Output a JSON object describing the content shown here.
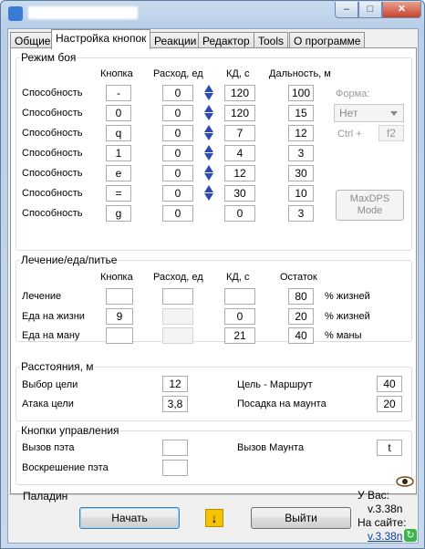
{
  "window": {
    "close_glyph": "✕",
    "min_glyph": "–",
    "max_glyph": "□"
  },
  "tabs": [
    "Общие",
    "Настройка кнопок",
    "Реакции",
    "Редактор",
    "Tools",
    "О программе"
  ],
  "combat": {
    "legend": "Режим боя",
    "headers": {
      "key": "Кнопка",
      "cost": "Расход, ед",
      "cd": "КД, с",
      "range": "Дальность, м"
    },
    "rows": [
      {
        "label": "Способность",
        "key": "-",
        "cost": "0",
        "cd": "120",
        "range": "100"
      },
      {
        "label": "Способность",
        "key": "0",
        "cost": "0",
        "cd": "120",
        "range": "15"
      },
      {
        "label": "Способность",
        "key": "q",
        "cost": "0",
        "cd": "7",
        "range": "12"
      },
      {
        "label": "Способность",
        "key": "1",
        "cost": "0",
        "cd": "4",
        "range": "3"
      },
      {
        "label": "Способность",
        "key": "e",
        "cost": "0",
        "cd": "12",
        "range": "30"
      },
      {
        "label": "Способность",
        "key": "=",
        "cost": "0",
        "cd": "30",
        "range": "10"
      },
      {
        "label": "Способность",
        "key": "g",
        "cost": "0",
        "cd": "0",
        "range": "3"
      }
    ],
    "form_label": "Форма:",
    "form_value": "Нет",
    "ctrl_label": "Ctrl +",
    "ctrl_key": "f2",
    "maxdps_line1": "MaxDPS",
    "maxdps_line2": "Mode"
  },
  "healing": {
    "legend": "Лечение/еда/питье",
    "headers": {
      "key": "Кнопка",
      "cost": "Расход, ед",
      "cd": "КД, с",
      "rest": "Остаток"
    },
    "rows": [
      {
        "label": "Лечение",
        "key": "",
        "cost": "",
        "cd": "",
        "rest": "80",
        "unit": "% жизней"
      },
      {
        "label": "Еда на жизни",
        "key": "9",
        "cost": "",
        "cd": "0",
        "rest": "20",
        "unit": "% жизней"
      },
      {
        "label": "Еда на ману",
        "key": "",
        "cost": "",
        "cd": "21",
        "rest": "40",
        "unit": "% маны"
      }
    ]
  },
  "distances": {
    "legend": "Расстояния, м",
    "target_select_label": "Выбор цели",
    "target_select_value": "12",
    "target_attack_label": "Атака цели",
    "target_attack_value": "3,8",
    "route_label": "Цель - Маршрут",
    "route_value": "40",
    "mount_land_label": "Посадка на маунта",
    "mount_land_value": "20"
  },
  "controls": {
    "legend": "Кнопки управления",
    "summon_pet_label": "Вызов пэта",
    "summon_pet_value": "",
    "revive_pet_label": "Воскрешение пэта",
    "revive_pet_value": "",
    "summon_mount_label": "Вызов Маунта",
    "summon_mount_value": "t"
  },
  "footer": {
    "class_name": "Паладин",
    "start_label": "Начать",
    "exit_label": "Выйти",
    "you_have_label": "У Вас:",
    "local_version": "v.3.38n",
    "site_label": "На сайте:",
    "site_version": "v.3.38n"
  },
  "colors": {
    "arrow": "#2d4bb5",
    "link": "#0a3fa8",
    "download": "#f5c400"
  }
}
